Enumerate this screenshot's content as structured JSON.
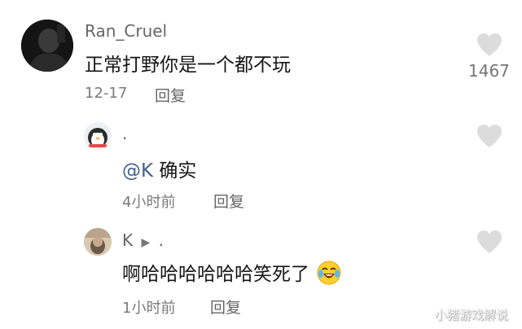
{
  "comments": [
    {
      "username": "Ran_Cruel",
      "text": "正常打野你是一个都不玩",
      "date": "12-17",
      "reply_label": "回复",
      "like_count": "1467"
    }
  ],
  "replies": [
    {
      "username": ".",
      "mention": "@K",
      "text": " 确实",
      "time": "4小时前",
      "reply_label": "回复"
    },
    {
      "username": "K",
      "arrow": "▶",
      "reply_to": ".",
      "text": "啊哈哈哈哈哈哈笑死了",
      "emoji": "laughing-crying-emoji",
      "time": "1小时前",
      "reply_label": "回复"
    }
  ],
  "watermark": "小猪游戏解说",
  "icons": {
    "like": "heart-icon",
    "avatar": "avatar"
  },
  "colors": {
    "heart": "#dcdcdc",
    "mention": "#3f5f8e",
    "text": "#161616"
  }
}
